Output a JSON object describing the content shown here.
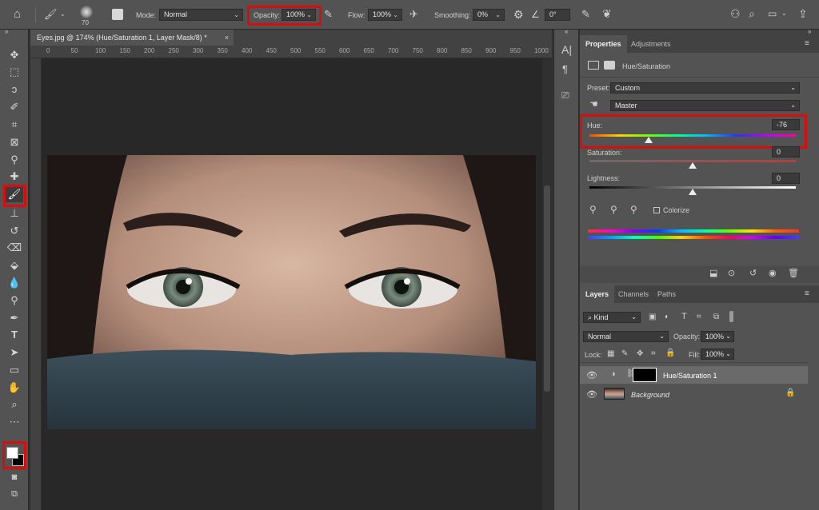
{
  "options_bar": {
    "brush_size": "70",
    "mode_label": "Mode:",
    "mode_value": "Normal",
    "opacity_label": "Opacity:",
    "opacity_value": "100%",
    "flow_label": "Flow:",
    "flow_value": "100%",
    "smoothing_label": "Smoothing:",
    "smoothing_value": "0%",
    "angle_value": "0°"
  },
  "document": {
    "tab_title": "Eyes.jpg @ 174% (Hue/Saturation 1, Layer Mask/8) *",
    "ruler_ticks": [
      "0",
      "50",
      "100",
      "150",
      "200",
      "250",
      "300",
      "350",
      "400",
      "450",
      "500",
      "550",
      "600",
      "650",
      "700",
      "750",
      "800",
      "850",
      "900",
      "950",
      "1000"
    ]
  },
  "properties": {
    "tabs": [
      "Properties",
      "Adjustments"
    ],
    "adjustment_title": "Hue/Saturation",
    "preset_label": "Preset:",
    "preset_value": "Custom",
    "channel_value": "Master",
    "hue_label": "Hue:",
    "hue_value": "-76",
    "hue_level": 0.288,
    "saturation_label": "Saturation:",
    "saturation_value": "0",
    "saturation_level": 0.5,
    "lightness_label": "Lightness:",
    "lightness_value": "0",
    "lightness_level": 0.5,
    "colorize_label": "Colorize"
  },
  "layers": {
    "tabs": [
      "Layers",
      "Channels",
      "Paths"
    ],
    "filter_value": "Kind",
    "blend_mode": "Normal",
    "opacity_label": "Opacity:",
    "opacity_value": "100%",
    "lock_label": "Lock:",
    "fill_label": "Fill:",
    "fill_value": "100%",
    "items": [
      {
        "name": "Hue/Saturation 1"
      },
      {
        "name": "Background"
      }
    ]
  },
  "colors": {
    "highlight": "#d90d0d",
    "panel": "#535353",
    "canvas": "#282828"
  }
}
